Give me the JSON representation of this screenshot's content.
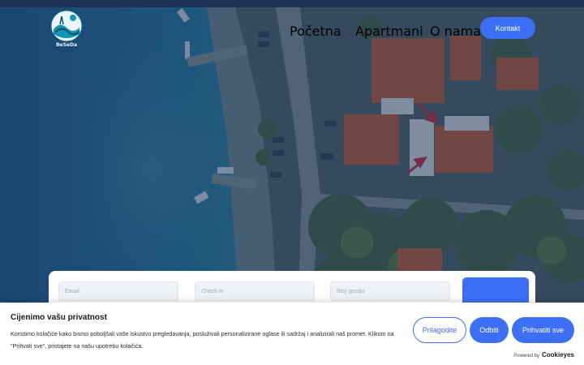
{
  "header": {
    "logo_text": "BeSeDa",
    "nav": [
      {
        "label": "Početna"
      },
      {
        "label": "Apartmani"
      },
      {
        "label": "O nama"
      }
    ],
    "contact_button": "Kontakt"
  },
  "booking": {
    "email_placeholder": "Email",
    "checkin_placeholder": "Check-in",
    "guests_placeholder": "Broj gostiju"
  },
  "cookie": {
    "title": "Cijenimo vašu privatnost",
    "text": "Koristimo kolačiće kako bismo poboljšali vaše iskustvo pregledavanja, posluživali personalizirane oglase ili sadržaj i analizirali naš promet. Klikom na \"Prihvati sve\", pristajete na našu upotrebu kolačića.",
    "customize_button": "Prilagodite",
    "reject_button": "Odbiti",
    "accept_button": "Prihvatiti sve",
    "powered_by": "Powered by",
    "powered_brand": "Cookieyes"
  },
  "colors": {
    "accent": "#3d6ff5",
    "sea": "#1e5a8a",
    "overlay": "#1c3b63"
  }
}
